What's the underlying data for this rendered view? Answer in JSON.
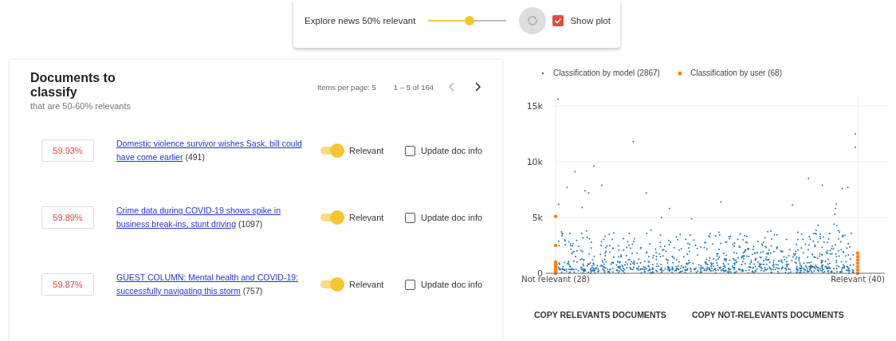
{
  "toolbar": {
    "slider_label": "Explore news 50% relevant",
    "slider": {
      "level": 0.53
    },
    "refresh": {
      "disabled": true
    },
    "show_plot": {
      "label": "Show plot",
      "checked": true
    }
  },
  "documents": {
    "title": "Documents to classify",
    "subtitle": "that are 50-60% relevants",
    "items_per_page": "Items per page: 5",
    "range": "1 – 5 of 164",
    "prev": {
      "disabled": true
    },
    "next": {
      "disabled": false
    },
    "rows": [
      {
        "score": "59.93%",
        "title": "Domestic violence survivor wishes Sask. bill could have come earlier",
        "count": "(491)",
        "relevant": true,
        "relevant_label": "Relevant",
        "update_label": "Update doc info",
        "update": false
      },
      {
        "score": "59.89%",
        "title": "Crime data during COVID-19 shows spike in business break-ins, stunt driving",
        "count": "(1097)",
        "relevant": true,
        "relevant_label": "Relevant",
        "update_label": "Update doc info",
        "update": false
      },
      {
        "score": "59.87%",
        "title": "GUEST COLUMN: Mental health and COVID-19: successfully navigating this storm",
        "count": "(757)",
        "relevant": true,
        "relevant_label": "Relevant",
        "update_label": "Update doc info",
        "update": false
      }
    ]
  },
  "plot": {
    "legend": [
      {
        "label": "Classification by model (2867)",
        "color": "#1f77b4"
      },
      {
        "label": "Classification by user (68)",
        "color": "#ff7f0e"
      }
    ],
    "y_labels": [
      "15k",
      "10k",
      "5k",
      "0"
    ],
    "x_labels": [
      "Not relevant (28)",
      "Relevant (40)"
    ]
  },
  "actions": [
    "COPY RELEVANTS DOCUMENTS",
    "COPY NOT-RELEVANTS DOCUMENTS"
  ]
}
